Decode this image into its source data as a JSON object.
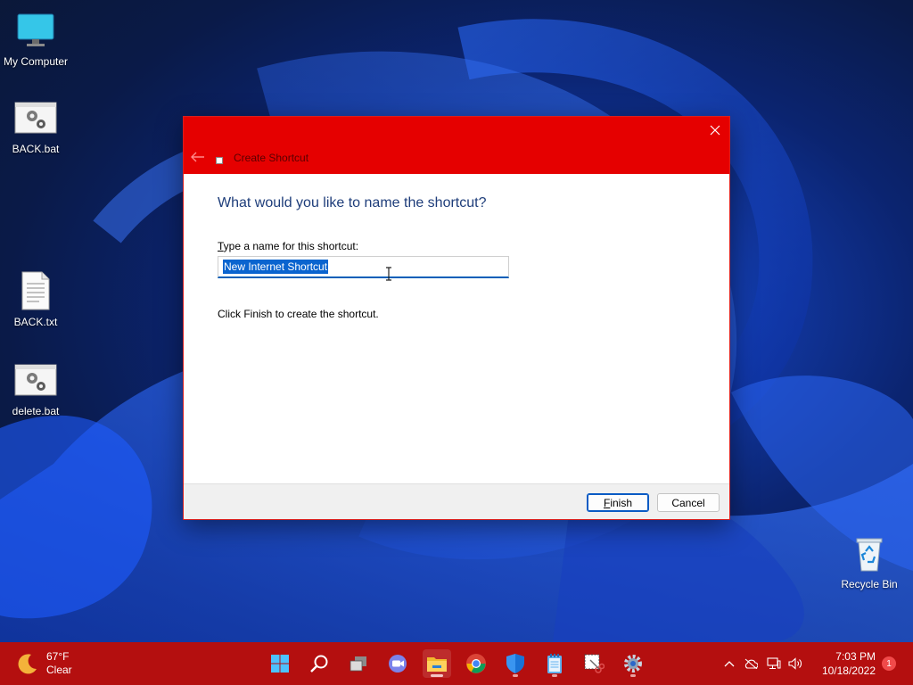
{
  "desktop": {
    "icons": [
      {
        "label": "My Computer",
        "icon": "monitor-icon"
      },
      {
        "label": "BACK.bat",
        "icon": "batch-file-icon"
      },
      {
        "label": "BACK.txt",
        "icon": "text-file-icon"
      },
      {
        "label": "delete.bat",
        "icon": "batch-file-icon"
      },
      {
        "label": "Recycle Bin",
        "icon": "recycle-bin-icon"
      }
    ]
  },
  "dialog": {
    "title": "Create Shortcut",
    "heading": "What would you like to name the shortcut?",
    "field_label_underlined": "T",
    "field_label_rest": "ype a name for this shortcut:",
    "name_value": "New Internet Shortcut",
    "hint": "Click Finish to create the shortcut.",
    "finish_underlined": "F",
    "finish_rest": "inish",
    "cancel_label": "Cancel"
  },
  "taskbar": {
    "weather_temp": "67°F",
    "weather_cond": "Clear",
    "apps": [
      "start-icon",
      "search-icon",
      "task-view-icon",
      "teams-chat-icon",
      "file-explorer-icon",
      "chrome-icon",
      "security-icon",
      "notepad-icon",
      "snipping-tool-icon",
      "settings-icon"
    ],
    "time": "7:03 PM",
    "date": "10/18/2022",
    "notification_count": "1"
  },
  "colors": {
    "titlebar": "#e50000",
    "taskbar": "#b40f0f",
    "accent": "#005fb8"
  }
}
